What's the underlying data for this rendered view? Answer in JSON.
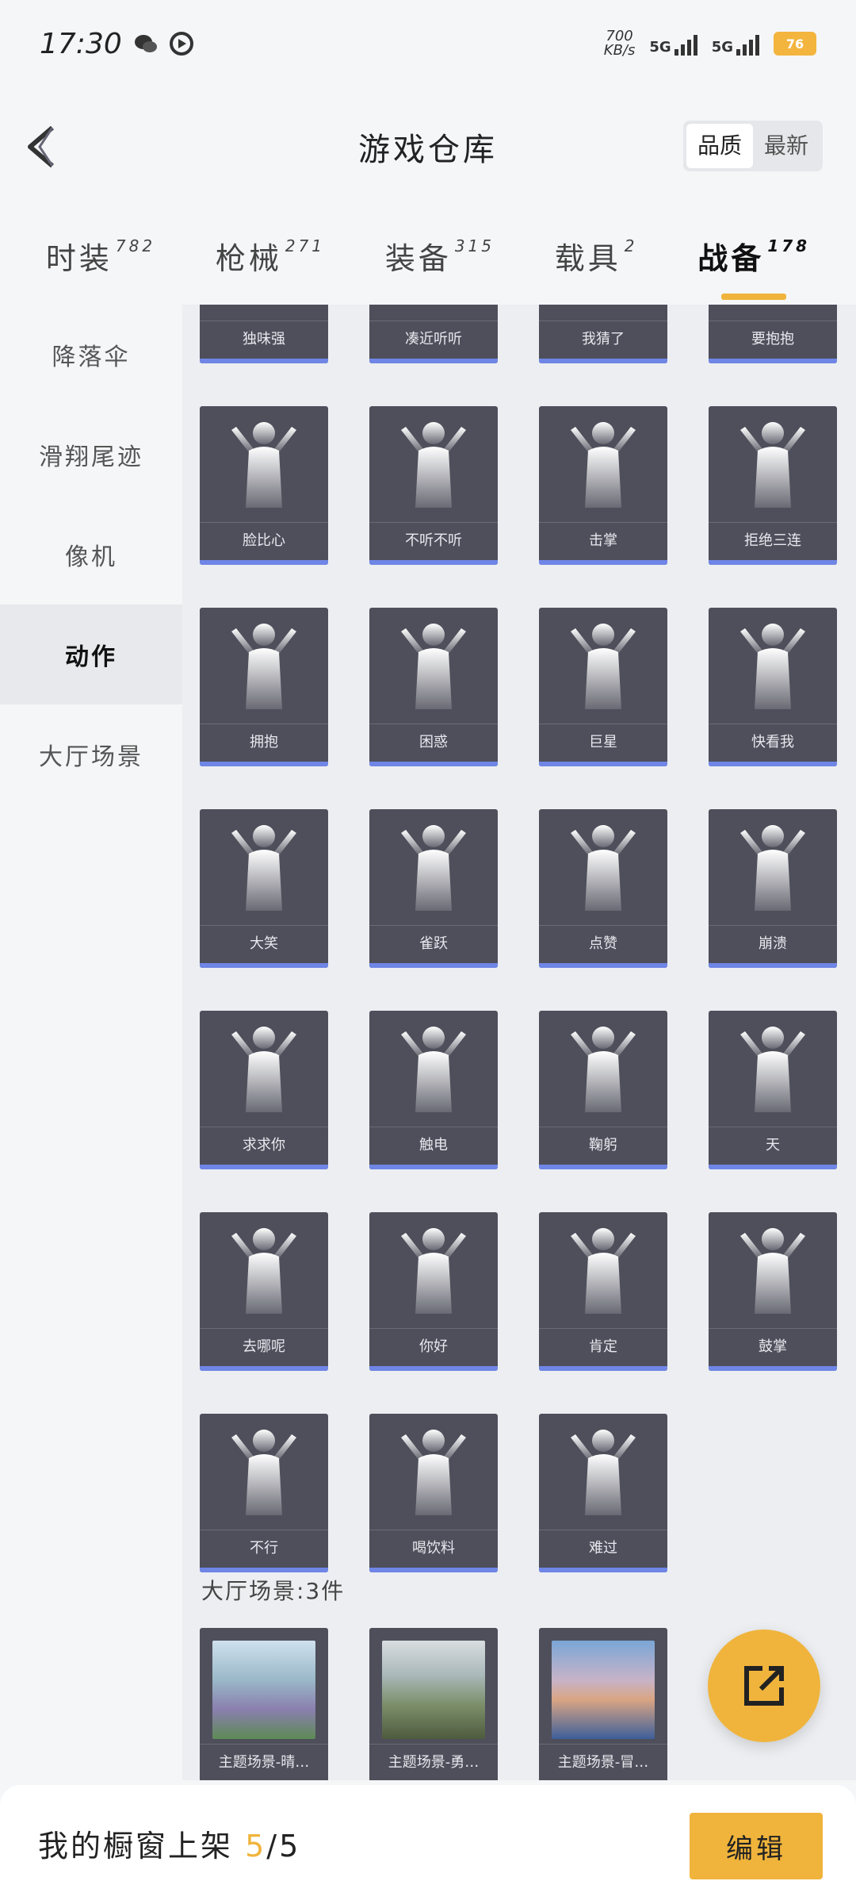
{
  "status": {
    "time": "17:30",
    "speed": "700",
    "speed_unit": "KB/s",
    "net1": "5G",
    "net2": "5G",
    "battery": "76"
  },
  "header": {
    "title": "游戏仓库",
    "sort_quality": "品质",
    "sort_latest": "最新"
  },
  "tabs": [
    {
      "label": "时装",
      "count": "782"
    },
    {
      "label": "枪械",
      "count": "271"
    },
    {
      "label": "装备",
      "count": "315"
    },
    {
      "label": "载具",
      "count": "2"
    },
    {
      "label": "战备",
      "count": "178"
    }
  ],
  "sidebar": {
    "items": [
      "降落伞",
      "滑翔尾迹",
      "像机",
      "动作",
      "大厅场景"
    ],
    "active": "动作"
  },
  "actions": {
    "partial_row": [
      "独味强",
      "凑近听听",
      "我猜了",
      "要抱抱"
    ],
    "rows": [
      [
        "脸比心",
        "不听不听",
        "击掌",
        "拒绝三连"
      ],
      [
        "拥抱",
        "困惑",
        "巨星",
        "快看我"
      ],
      [
        "大笑",
        "雀跃",
        "点赞",
        "崩溃"
      ],
      [
        "求求你",
        "触电",
        "鞠躬",
        "天"
      ],
      [
        "去哪呢",
        "你好",
        "肯定",
        "鼓掌"
      ],
      [
        "不行",
        "喝饮料",
        "难过"
      ]
    ]
  },
  "scenes": {
    "title": "大厅场景:3件",
    "items": [
      "主题场景-晴…",
      "主题场景-勇…",
      "主题场景-冒…"
    ]
  },
  "bottom": {
    "text_prefix": "我的橱窗上架",
    "count": "5",
    "total": "/5",
    "edit": "编辑"
  },
  "colors": {
    "accent": "#f0b43c",
    "card": "#4e4f5b",
    "rarity_bar": "#6f86e6"
  }
}
